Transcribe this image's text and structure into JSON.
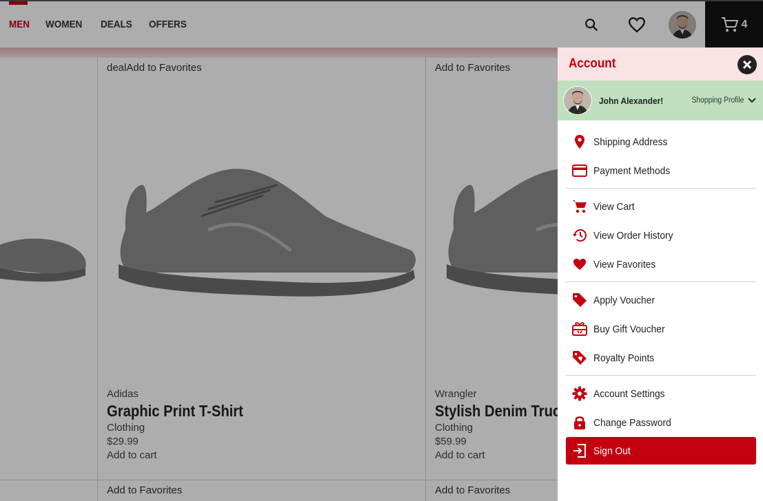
{
  "header": {
    "nav": [
      {
        "label": "MEN",
        "active": true
      },
      {
        "label": "WOMEN",
        "active": false
      },
      {
        "label": "DEALS",
        "active": false
      },
      {
        "label": "OFFERS",
        "active": false
      }
    ],
    "cart_count": "4",
    "colors": {
      "accent": "#c4000f",
      "cart_bg": "#141414"
    }
  },
  "products": [
    {
      "fav_label": "",
      "brand": "",
      "name": "",
      "category": "",
      "price": "",
      "cart_label": "",
      "fav_label_bottom": ""
    },
    {
      "fav_label": "dealAdd to Favorites",
      "brand": "Adidas",
      "name": "Graphic Print T-Shirt",
      "category": "Clothing",
      "price": "$29.99",
      "cart_label": "Add to cart",
      "fav_label_bottom": "Add to Favorites"
    },
    {
      "fav_label": "Add to Favorites",
      "brand": "Wrangler",
      "name": "Stylish Denim Truc",
      "category": "Clothing",
      "price": "$59.99",
      "cart_label": "Add to cart",
      "fav_label_bottom": "Add to Favorites"
    }
  ],
  "account": {
    "title": "Account",
    "user_name": "John Alexander!",
    "profile_toggle": "Shopping Profile",
    "groups": [
      [
        {
          "label": "Shipping Address",
          "icon": "location-pin-icon"
        },
        {
          "label": "Payment Methods",
          "icon": "credit-card-icon"
        }
      ],
      [
        {
          "label": "View Cart",
          "icon": "cart-icon"
        },
        {
          "label": "View Order History",
          "icon": "history-icon"
        },
        {
          "label": "View Favorites",
          "icon": "heart-icon"
        }
      ],
      [
        {
          "label": "Apply Voucher",
          "icon": "tag-icon"
        },
        {
          "label": "Buy Gift Voucher",
          "icon": "gift-card-icon"
        },
        {
          "label": "Royalty Points",
          "icon": "loyalty-tag-icon"
        }
      ],
      [
        {
          "label": "Account Settings",
          "icon": "gear-icon"
        },
        {
          "label": "Change Password",
          "icon": "lock-icon"
        },
        {
          "label": "Sign Out",
          "icon": "sign-out-icon"
        }
      ]
    ],
    "colors": {
      "header_bg": "#f9e3e4",
      "profile_bg": "#bfe0bf",
      "signout_bg": "#c4000f"
    }
  }
}
